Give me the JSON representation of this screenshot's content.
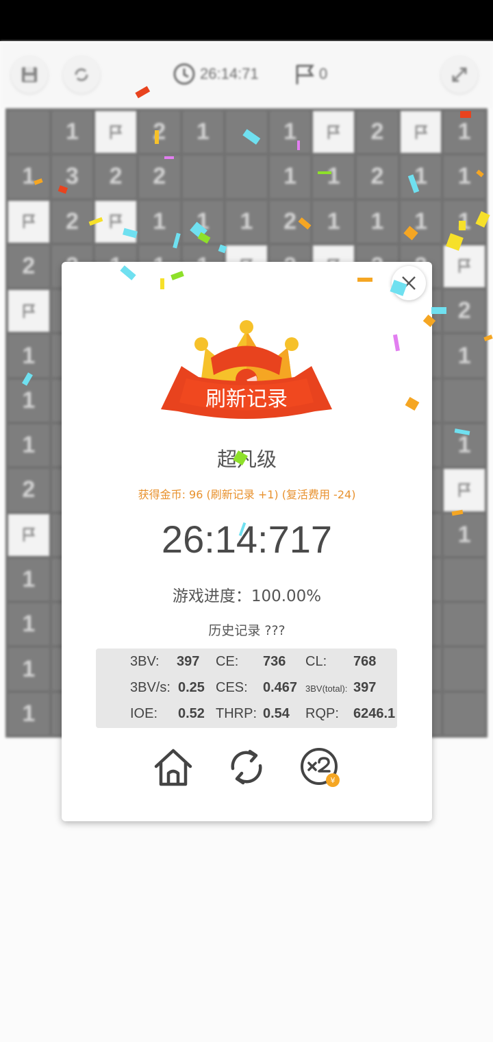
{
  "toolbar": {
    "timer": "26:14:71",
    "flags": "0"
  },
  "board": {
    "rows": [
      [
        "",
        "1",
        "F",
        "2",
        "1",
        "",
        "1",
        "F",
        "2",
        "F",
        "1"
      ],
      [
        "1",
        "3",
        "2",
        "2",
        "",
        "",
        "1",
        "1",
        "2",
        "1",
        "1"
      ],
      [
        "F",
        "2",
        "F",
        "1",
        "1",
        "1",
        "2",
        "1",
        "1",
        "1",
        "1"
      ],
      [
        "2",
        "2",
        "1",
        "1",
        "1",
        "F",
        "2",
        "F",
        "2",
        "2",
        "F"
      ],
      [
        "F",
        "",
        "",
        "",
        "",
        "",
        "",
        "",
        "",
        "",
        "2"
      ],
      [
        "1",
        "",
        "",
        "",
        "",
        "",
        "",
        "",
        "",
        "",
        "1"
      ],
      [
        "1",
        "",
        "",
        "",
        "",
        "",
        "",
        "",
        "",
        "",
        ""
      ],
      [
        "1",
        "",
        "",
        "",
        "",
        "",
        "",
        "",
        "",
        "",
        "1"
      ],
      [
        "2",
        "",
        "",
        "",
        "",
        "",
        "",
        "",
        "",
        "",
        "F"
      ],
      [
        "F",
        "",
        "",
        "",
        "",
        "",
        "",
        "",
        "",
        "",
        "1"
      ],
      [
        "1",
        "",
        "",
        "",
        "",
        "",
        "",
        "",
        "",
        "",
        ""
      ],
      [
        "1",
        "",
        "",
        "",
        "",
        "",
        "",
        "",
        "",
        "",
        ""
      ],
      [
        "1",
        "",
        "",
        "",
        "",
        "",
        "",
        "",
        "",
        "",
        ""
      ],
      [
        "1",
        "",
        "",
        "",
        "",
        "",
        "",
        "",
        "",
        "",
        ""
      ]
    ]
  },
  "dialog": {
    "ribbon": "刷新记录",
    "rank": "超凡级",
    "coins": "获得金币: 96 (刷新记录 +1) (复活费用 -24)",
    "time": "26:14:717",
    "progress": "游戏进度：100.00%",
    "history": "历史记录 ???",
    "stats": {
      "bv_label": "3BV:",
      "bv": "397",
      "ce_label": "CE:",
      "ce": "736",
      "cl_label": "CL:",
      "cl": "768",
      "bvs_label": "3BV/s:",
      "bvs": "0.25",
      "ces_label": "CES:",
      "ces": "0.467",
      "bvtotal_label": "3BV(total):",
      "bvtotal": "397",
      "ioe_label": "IOE:",
      "ioe": "0.52",
      "thrp_label": "THRP:",
      "thrp": "0.54",
      "rqp_label": "RQP:",
      "rqp": "6246.1"
    },
    "x2_coin": "¥"
  },
  "colors": {
    "accent_orange": "#e8912d",
    "ribbon_red": "#e8431e",
    "crown_yellow": "#f6c12a"
  }
}
